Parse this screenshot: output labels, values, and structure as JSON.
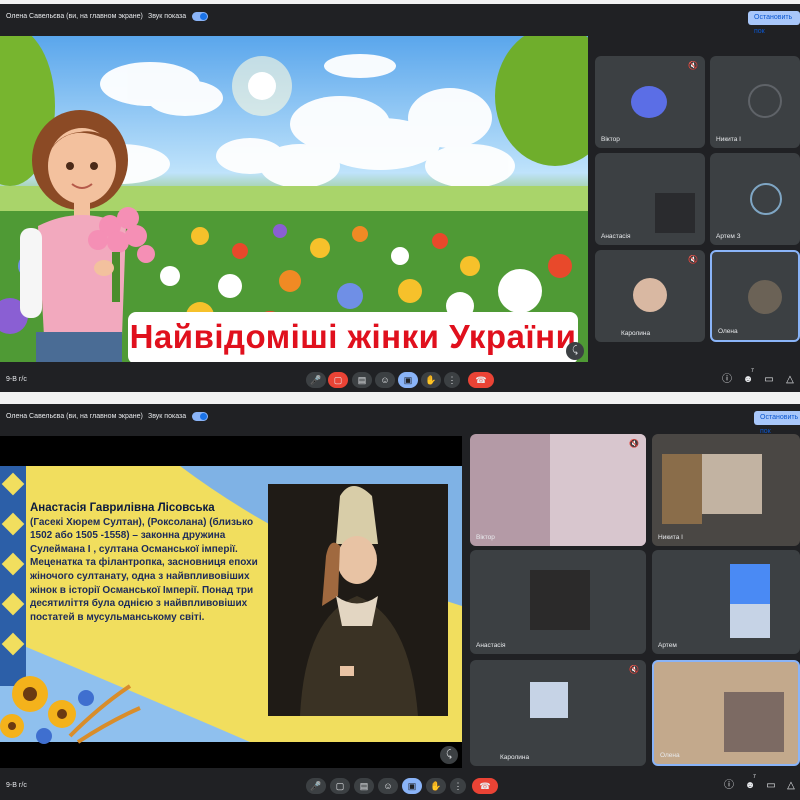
{
  "colors": {
    "panel_bg": "#202124",
    "tile_bg": "#3c4043",
    "accent": "#8ab4f8",
    "end_call": "#ea4335",
    "title_red": "#e0101d"
  },
  "header": {
    "presenter_label": "Олена Савельєва (ви, на главном экране)",
    "sound_label": "Звук показа",
    "stop_button": "Остановить пок"
  },
  "meeting": {
    "code": "9-В г/с"
  },
  "slide1": {
    "title": "Найвідоміші жінки України"
  },
  "slide2": {
    "name": "Анастасія Гаврилівна Лісовська",
    "body": "(Гасекі Хюрем Султан), (Роксолана) (близько 1502 або 1505 -1558) – законна дружина Сулеймана I , султана Османської імперії. Меценатка та філантропка, засновниця епохи жіночого султанату, одна з найвпливовіших жінок в історії Османської Імперії. Понад три десятиліття була однією з найвпливовіших постатей в мусульманському світі."
  },
  "participants_top": [
    "Віктор",
    "Никита I",
    "Анастасія",
    "Артем З",
    "Каролина",
    "Олена"
  ],
  "participants_bottom": [
    "Віктор",
    "Никита I",
    "Анастасія",
    "Артем",
    "Каролина",
    "Олена"
  ],
  "people_badge": "7",
  "icons": {
    "mic": "microphone-icon",
    "cam_off": "camera-off-icon",
    "cam": "camera-icon",
    "cc": "captions-icon",
    "emoji": "emoji-icon",
    "present": "present-icon",
    "hand": "raise-hand-icon",
    "more": "more-icon",
    "hangup": "end-call-icon",
    "info": "info-icon",
    "people": "people-icon",
    "chat": "chat-icon",
    "activities": "activities-icon"
  }
}
